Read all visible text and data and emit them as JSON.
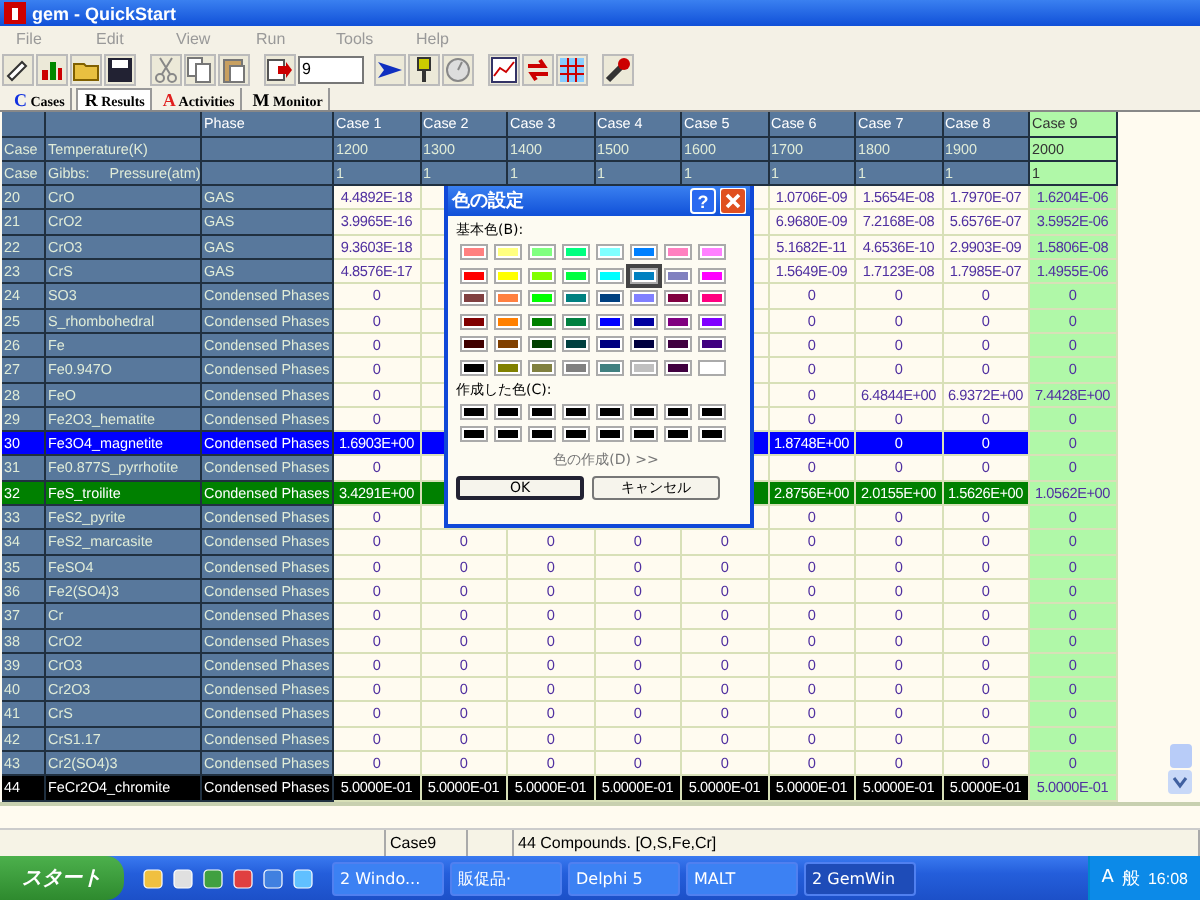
{
  "window": {
    "title": "gem - QuickStart"
  },
  "menu": [
    {
      "label": "File",
      "disabled": true
    },
    {
      "label": "Edit",
      "disabled": true
    },
    {
      "label": "View",
      "disabled": true
    },
    {
      "label": "Run",
      "disabled": true
    },
    {
      "label": "Tools",
      "disabled": true
    },
    {
      "label": "Help",
      "disabled": true
    }
  ],
  "toolbar": {
    "field_value": "9"
  },
  "tabs": [
    {
      "icon": "C",
      "label": "Cases",
      "selected": false
    },
    {
      "icon": "R",
      "label": "Results",
      "selected": true
    },
    {
      "icon": "A",
      "label": "Activities",
      "selected": false
    },
    {
      "icon": "M",
      "label": "Monitor",
      "selected": false
    }
  ],
  "table": {
    "phase_heading": "Phase",
    "case_columns": [
      {
        "label": "Case 1",
        "selected": false
      },
      {
        "label": "Case 2",
        "selected": false
      },
      {
        "label": "Case 3",
        "selected": false
      },
      {
        "label": "Case 4",
        "selected": false
      },
      {
        "label": "Case 5",
        "selected": false
      },
      {
        "label": "Case 6",
        "selected": false
      },
      {
        "label": "Case 7",
        "selected": false
      },
      {
        "label": "Case 8",
        "selected": false
      },
      {
        "label": "Case 9",
        "selected": true
      }
    ],
    "parameter_rows": [
      {
        "tag": "Case",
        "name": "Temperature(K)",
        "values": [
          "1200",
          "1300",
          "1400",
          "1500",
          "1600",
          "1700",
          "1800",
          "1900",
          "2000"
        ]
      },
      {
        "tag": "Case",
        "label": "Gibbs:",
        "name": "Pressure(atm)",
        "values": [
          "1",
          "1",
          "1",
          "1",
          "1",
          "1",
          "1",
          "1",
          "1"
        ]
      }
    ],
    "rows": [
      {
        "index": "20",
        "name": "CrO",
        "phase": "GAS",
        "covered": true,
        "values": [
          "4.4892E-18",
          "1.0706E-09",
          "1.5654E-08",
          "1.7970E-07",
          "1.6204E-06"
        ]
      },
      {
        "index": "21",
        "name": "CrO2",
        "phase": "GAS",
        "covered": true,
        "values": [
          "3.9965E-16",
          "6.9680E-09",
          "7.2168E-08",
          "5.6576E-07",
          "3.5952E-06"
        ]
      },
      {
        "index": "22",
        "name": "CrO3",
        "phase": "GAS",
        "covered": true,
        "values": [
          "9.3603E-18",
          "5.1682E-11",
          "4.6536E-10",
          "2.9903E-09",
          "1.5806E-08"
        ]
      },
      {
        "index": "23",
        "name": "CrS",
        "phase": "GAS",
        "covered": true,
        "values": [
          "4.8576E-17",
          "1.5649E-09",
          "1.7123E-08",
          "1.7985E-07",
          "1.4955E-06"
        ]
      },
      {
        "index": "24",
        "name": "SO3",
        "phase": "Condensed Phases",
        "covered": true,
        "values": [
          "0",
          "0",
          "0",
          "0",
          "0"
        ]
      },
      {
        "index": "25",
        "name": "S_rhombohedral",
        "phase": "Condensed Phases",
        "covered": true,
        "values": [
          "0",
          "0",
          "0",
          "0",
          "0"
        ]
      },
      {
        "index": "26",
        "name": "Fe",
        "phase": "Condensed Phases",
        "covered": true,
        "values": [
          "0",
          "0",
          "0",
          "0",
          "0"
        ]
      },
      {
        "index": "27",
        "name": "Fe0.947O",
        "phase": "Condensed Phases",
        "covered": true,
        "values": [
          "0",
          "0",
          "0",
          "0",
          "0"
        ]
      },
      {
        "index": "28",
        "name": "FeO",
        "phase": "Condensed Phases",
        "covered": true,
        "values": [
          "0",
          "0",
          "6.4844E+00",
          "6.9372E+00",
          "7.4428E+00"
        ]
      },
      {
        "index": "29",
        "name": "Fe2O3_hematite",
        "phase": "Condensed Phases",
        "covered": true,
        "values": [
          "0",
          "0",
          "0",
          "0",
          "0"
        ]
      },
      {
        "index": "30",
        "name": "Fe3O4_magnetite",
        "phase": "Condensed Phases",
        "color": "#0000ff",
        "covered": true,
        "values": [
          "1.6903E+00",
          "1.8748E+00",
          "0",
          "0",
          "0"
        ]
      },
      {
        "index": "31",
        "name": "Fe0.877S_pyrrhotite",
        "phase": "Condensed Phases",
        "covered": true,
        "values": [
          "0",
          "0",
          "0",
          "0",
          "0"
        ]
      },
      {
        "index": "32",
        "name": "FeS_troilite",
        "phase": "Condensed Phases",
        "color": "#008000",
        "covered": true,
        "values": [
          "3.4291E+00",
          "2.8756E+00",
          "2.0155E+00",
          "1.5626E+00",
          "1.0562E+00"
        ]
      },
      {
        "index": "33",
        "name": "FeS2_pyrite",
        "phase": "Condensed Phases",
        "covered": true,
        "values": [
          "0",
          "0",
          "0",
          "0",
          "0"
        ]
      },
      {
        "index": "34",
        "name": "FeS2_marcasite",
        "phase": "Condensed Phases",
        "values": [
          "0",
          "0",
          "0",
          "0",
          "0",
          "0",
          "0",
          "0",
          "0"
        ]
      },
      {
        "index": "35",
        "name": "FeSO4",
        "phase": "Condensed Phases",
        "values": [
          "0",
          "0",
          "0",
          "0",
          "0",
          "0",
          "0",
          "0",
          "0"
        ]
      },
      {
        "index": "36",
        "name": "Fe2(SO4)3",
        "phase": "Condensed Phases",
        "values": [
          "0",
          "0",
          "0",
          "0",
          "0",
          "0",
          "0",
          "0",
          "0"
        ]
      },
      {
        "index": "37",
        "name": "Cr",
        "phase": "Condensed Phases",
        "values": [
          "0",
          "0",
          "0",
          "0",
          "0",
          "0",
          "0",
          "0",
          "0"
        ]
      },
      {
        "index": "38",
        "name": "CrO2",
        "phase": "Condensed Phases",
        "values": [
          "0",
          "0",
          "0",
          "0",
          "0",
          "0",
          "0",
          "0",
          "0"
        ]
      },
      {
        "index": "39",
        "name": "CrO3",
        "phase": "Condensed Phases",
        "values": [
          "0",
          "0",
          "0",
          "0",
          "0",
          "0",
          "0",
          "0",
          "0"
        ]
      },
      {
        "index": "40",
        "name": "Cr2O3",
        "phase": "Condensed Phases",
        "values": [
          "0",
          "0",
          "0",
          "0",
          "0",
          "0",
          "0",
          "0",
          "0"
        ]
      },
      {
        "index": "41",
        "name": "CrS",
        "phase": "Condensed Phases",
        "values": [
          "0",
          "0",
          "0",
          "0",
          "0",
          "0",
          "0",
          "0",
          "0"
        ]
      },
      {
        "index": "42",
        "name": "CrS1.17",
        "phase": "Condensed Phases",
        "values": [
          "0",
          "0",
          "0",
          "0",
          "0",
          "0",
          "0",
          "0",
          "0"
        ]
      },
      {
        "index": "43",
        "name": "Cr2(SO4)3",
        "phase": "Condensed Phases",
        "values": [
          "0",
          "0",
          "0",
          "0",
          "0",
          "0",
          "0",
          "0",
          "0"
        ]
      },
      {
        "index": "44",
        "name": "FeCr2O4_chromite",
        "phase": "Condensed Phases",
        "color": "#000000",
        "values": [
          "5.0000E-01",
          "5.0000E-01",
          "5.0000E-01",
          "5.0000E-01",
          "5.0000E-01",
          "5.0000E-01",
          "5.0000E-01",
          "5.0000E-01",
          "5.0000E-01"
        ]
      }
    ]
  },
  "dialog": {
    "title": "色の設定",
    "help": "?",
    "basic_label": "基本色(B):",
    "basic_colors": [
      {
        "color": "#ff8080",
        "selected": false
      },
      {
        "color": "#ffff80",
        "selected": false
      },
      {
        "color": "#80ff80",
        "selected": false
      },
      {
        "color": "#00ff80",
        "selected": false
      },
      {
        "color": "#80ffff",
        "selected": false
      },
      {
        "color": "#0080ff",
        "selected": false
      },
      {
        "color": "#ff80c0",
        "selected": false
      },
      {
        "color": "#ff80ff",
        "selected": false
      },
      {
        "color": "#ff0000",
        "selected": false
      },
      {
        "color": "#ffff00",
        "selected": false
      },
      {
        "color": "#80ff00",
        "selected": false
      },
      {
        "color": "#00ff40",
        "selected": false
      },
      {
        "color": "#00ffff",
        "selected": false
      },
      {
        "color": "#0080c0",
        "selected": true
      },
      {
        "color": "#8080c0",
        "selected": false
      },
      {
        "color": "#ff00ff",
        "selected": false
      },
      {
        "color": "#804040",
        "selected": false
      },
      {
        "color": "#ff8040",
        "selected": false
      },
      {
        "color": "#00ff00",
        "selected": false
      },
      {
        "color": "#008080",
        "selected": false
      },
      {
        "color": "#004080",
        "selected": false
      },
      {
        "color": "#8080ff",
        "selected": false
      },
      {
        "color": "#800040",
        "selected": false
      },
      {
        "color": "#ff0080",
        "selected": false
      },
      {
        "color": "#800000",
        "selected": false
      },
      {
        "color": "#ff8000",
        "selected": false
      },
      {
        "color": "#008000",
        "selected": false
      },
      {
        "color": "#008040",
        "selected": false
      },
      {
        "color": "#0000ff",
        "selected": false
      },
      {
        "color": "#0000a0",
        "selected": false
      },
      {
        "color": "#800080",
        "selected": false
      },
      {
        "color": "#8000ff",
        "selected": false
      },
      {
        "color": "#400000",
        "selected": false
      },
      {
        "color": "#804000",
        "selected": false
      },
      {
        "color": "#004000",
        "selected": false
      },
      {
        "color": "#004040",
        "selected": false
      },
      {
        "color": "#000080",
        "selected": false
      },
      {
        "color": "#000040",
        "selected": false
      },
      {
        "color": "#400040",
        "selected": false
      },
      {
        "color": "#400080",
        "selected": false
      },
      {
        "color": "#000000",
        "selected": false
      },
      {
        "color": "#808000",
        "selected": false
      },
      {
        "color": "#808040",
        "selected": false
      },
      {
        "color": "#808080",
        "selected": false
      },
      {
        "color": "#408080",
        "selected": false
      },
      {
        "color": "#c0c0c0",
        "selected": false
      },
      {
        "color": "#400040",
        "selected": false
      },
      {
        "color": "#ffffff",
        "selected": false
      }
    ],
    "custom_label": "作成した色(C):",
    "custom_colors": [
      {
        "color": "#000000"
      },
      {
        "color": "#000000"
      },
      {
        "color": "#000000"
      },
      {
        "color": "#000000"
      },
      {
        "color": "#000000"
      },
      {
        "color": "#000000"
      },
      {
        "color": "#000000"
      },
      {
        "color": "#000000"
      },
      {
        "color": "#000000"
      },
      {
        "color": "#000000"
      },
      {
        "color": "#000000"
      },
      {
        "color": "#000000"
      },
      {
        "color": "#000000"
      },
      {
        "color": "#000000"
      },
      {
        "color": "#000000"
      },
      {
        "color": "#000000"
      }
    ],
    "define_button": {
      "label": "色の作成(D) >>",
      "disabled": true
    },
    "ok": "OK",
    "cancel": "キャンセル"
  },
  "status_bar": {
    "case": "Case9",
    "info": "44 Compounds. [O,S,Fe,Cr]"
  },
  "taskbar": {
    "start": "スタート",
    "tasks": [
      {
        "label": "2 Windo...",
        "selected": false
      },
      {
        "label": "販促品·",
        "selected": false
      },
      {
        "label": "Delphi 5",
        "selected": false
      },
      {
        "label": "MALT",
        "selected": false
      },
      {
        "label": "2 GemWin",
        "selected": true
      }
    ],
    "tray": [
      "A",
      "般"
    ],
    "clock": "16:08"
  }
}
